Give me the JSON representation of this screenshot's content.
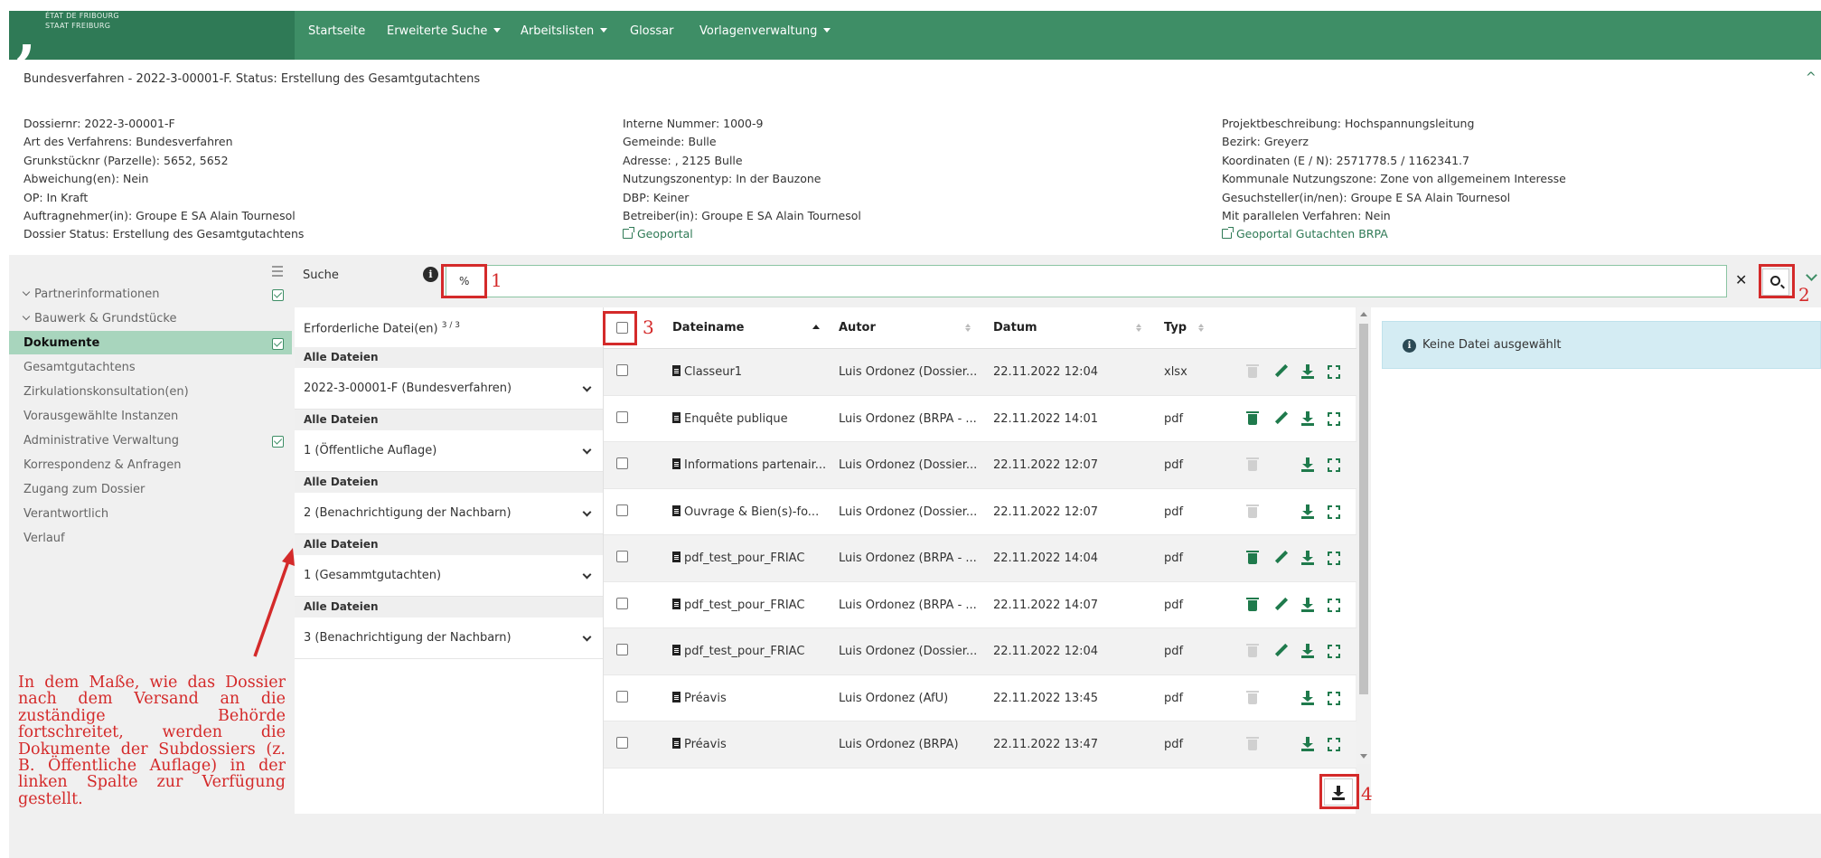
{
  "brand": {
    "line1": "ÉTAT DE FRIBOURG",
    "line2": "STAAT FREIBURG"
  },
  "nav": {
    "items": [
      {
        "label": "Startseite",
        "dropdown": false
      },
      {
        "label": "Erweiterte Suche",
        "dropdown": true
      },
      {
        "label": "Arbeitslisten",
        "dropdown": true
      },
      {
        "label": "Glossar",
        "dropdown": false
      },
      {
        "label": "Vorlagenverwaltung",
        "dropdown": true
      }
    ]
  },
  "header": {
    "title": "Bundesverfahren - 2022-3-00001-F. Status: Erstellung des Gesamtgutachtens",
    "col1": [
      "Dossiernr: 2022-3-00001-F",
      "Art des Verfahrens: Bundesverfahren",
      "Grunkstücknr (Parzelle): 5652, 5652",
      "Abweichung(en): Nein",
      "OP: In Kraft",
      "Auftragnehmer(in): Groupe E SA Alain Tournesol",
      "Dossier Status: Erstellung des Gesamtgutachtens"
    ],
    "col2": [
      "Interne Nummer: 1000-9",
      "Gemeinde: Bulle",
      "Adresse: , 2125 Bulle",
      "Nutzungszonentyp: In der Bauzone",
      "DBP: Keiner",
      "Betreiber(in): Groupe E SA Alain Tournesol"
    ],
    "col2_link": "Geoportal",
    "col3": [
      "Projektbeschreibung: Hochspannungsleitung",
      "Bezirk: Greyerz",
      "Koordinaten (E / N): 2571778.5 / 1162341.7",
      "Kommunale Nutzungszone: Zone von allgemeinem Interesse",
      "Gesuchsteller(in/nen): Groupe E SA Alain Tournesol",
      "Mit parallelen Verfahren: Nein"
    ],
    "col3_link": "Geoportal Gutachten BRPA"
  },
  "sidebar": {
    "items": [
      {
        "label": "Partnerinformationen",
        "chevron": true,
        "checked": true
      },
      {
        "label": "Bauwerk & Grundstücke",
        "chevron": true,
        "checked": false
      },
      {
        "label": "Dokumente",
        "active": true,
        "checked": true
      },
      {
        "label": "Gesamtgutachtens"
      },
      {
        "label": "Zirkulationskonsultation(en)"
      },
      {
        "label": "Vorausgewählte Instanzen"
      },
      {
        "label": "Administrative Verwaltung",
        "checked": true
      },
      {
        "label": "Korrespondenz & Anfragen"
      },
      {
        "label": "Zugang zum Dossier"
      },
      {
        "label": "Verantwortlich"
      },
      {
        "label": "Verlauf"
      }
    ]
  },
  "annotation": {
    "text": "In dem Maße, wie das Dossier nach dem Versand an die zuständige Behörde fortschreitet, werden die Dokumente der Subdossiers (z. B. Öffentliche Auflage) in der linken Spalte zur Verfügung gestellt.",
    "markers": [
      "1",
      "2",
      "3",
      "4"
    ]
  },
  "search": {
    "label": "Suche",
    "info_glyph": "i",
    "value": "%",
    "clear_glyph": "✕"
  },
  "filters": {
    "required_label": "Erforderliche Datei(en)",
    "required_count": "3 / 3",
    "groups": [
      {
        "section": "Alle Dateien",
        "value": "2022-3-00001-F (Bundesverfahren)"
      },
      {
        "section": "Alle Dateien",
        "value": "1 (Öffentliche Auflage)"
      },
      {
        "section": "Alle Dateien",
        "value": "2 (Benachrichtigung der Nachbarn)"
      },
      {
        "section": "Alle Dateien",
        "value": "1 (Gesammtgutachten)"
      },
      {
        "section": "Alle Dateien",
        "value": "3 (Benachrichtigung der Nachbarn)"
      }
    ]
  },
  "table": {
    "columns": [
      "Dateiname",
      "Autor",
      "Datum",
      "Typ"
    ],
    "rows": [
      {
        "name": "Classeur1",
        "author": "Luis Ordonez (Dossier...",
        "date": "22.11.2022 12:04",
        "type": "xlsx",
        "trash": false,
        "edit": true
      },
      {
        "name": "Enquête publique",
        "author": "Luis Ordonez (BRPA - ...",
        "date": "22.11.2022 14:01",
        "type": "pdf",
        "trash": true,
        "edit": true
      },
      {
        "name": "Informations partenair...",
        "author": "Luis Ordonez (Dossier...",
        "date": "22.11.2022 12:07",
        "type": "pdf",
        "trash": false,
        "edit": false
      },
      {
        "name": "Ouvrage & Bien(s)-fo...",
        "author": "Luis Ordonez (Dossier...",
        "date": "22.11.2022 12:07",
        "type": "pdf",
        "trash": false,
        "edit": false
      },
      {
        "name": "pdf_test_pour_FRIAC",
        "author": "Luis Ordonez (BRPA - ...",
        "date": "22.11.2022 14:04",
        "type": "pdf",
        "trash": true,
        "edit": true
      },
      {
        "name": "pdf_test_pour_FRIAC",
        "author": "Luis Ordonez (BRPA - ...",
        "date": "22.11.2022 14:07",
        "type": "pdf",
        "trash": true,
        "edit": true
      },
      {
        "name": "pdf_test_pour_FRIAC",
        "author": "Luis Ordonez (Dossier...",
        "date": "22.11.2022 12:04",
        "type": "pdf",
        "trash": false,
        "edit": true
      },
      {
        "name": "Préavis",
        "author": "Luis Ordonez (AfU)",
        "date": "22.11.2022 13:45",
        "type": "pdf",
        "trash": false,
        "edit": false
      },
      {
        "name": "Préavis",
        "author": "Luis Ordonez (BRPA)",
        "date": "22.11.2022 13:47",
        "type": "pdf",
        "trash": false,
        "edit": false
      }
    ]
  },
  "rightpanel": {
    "message": "Keine Datei ausgewählt",
    "info_glyph": "i"
  },
  "colors": {
    "nav": "#3e8e66",
    "brand": "#2f7a56",
    "accent": "#1f7a4c",
    "annotation": "#d42a2a",
    "active_item": "#a8d5bd"
  }
}
